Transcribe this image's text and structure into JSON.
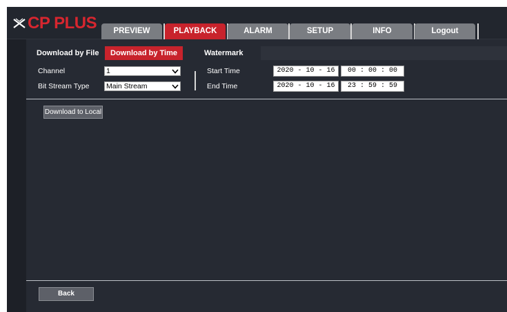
{
  "brand": {
    "name": "CP PLUS",
    "color": "#d7262f"
  },
  "nav": {
    "tabs": [
      {
        "label": "PREVIEW"
      },
      {
        "label": "PLAYBACK"
      },
      {
        "label": "ALARM"
      },
      {
        "label": "SETUP"
      },
      {
        "label": "INFO"
      },
      {
        "label": "Logout"
      }
    ],
    "active_tab": "PLAYBACK",
    "active_color": "#c8232c"
  },
  "subtabs": {
    "items": [
      {
        "label": "Download by File"
      },
      {
        "label": "Download by Time"
      },
      {
        "label": "Watermark"
      }
    ],
    "active": "Download by Time"
  },
  "form": {
    "channel_label": "Channel",
    "channel_value": "1",
    "stream_label": "Bit Stream Type",
    "stream_value": "Main Stream",
    "start_label": "Start Time",
    "start_date": "2020 - 10 - 16",
    "start_time": "00 : 00 : 00",
    "end_label": "End Time",
    "end_date": "2020 - 10 - 16",
    "end_time": "23 : 59 : 59"
  },
  "actions": {
    "download_label": "Download to Local",
    "back_label": "Back"
  },
  "icons": {
    "logo": "cp-plus-x-mark-icon",
    "dropdown": "chevron-down-icon"
  }
}
